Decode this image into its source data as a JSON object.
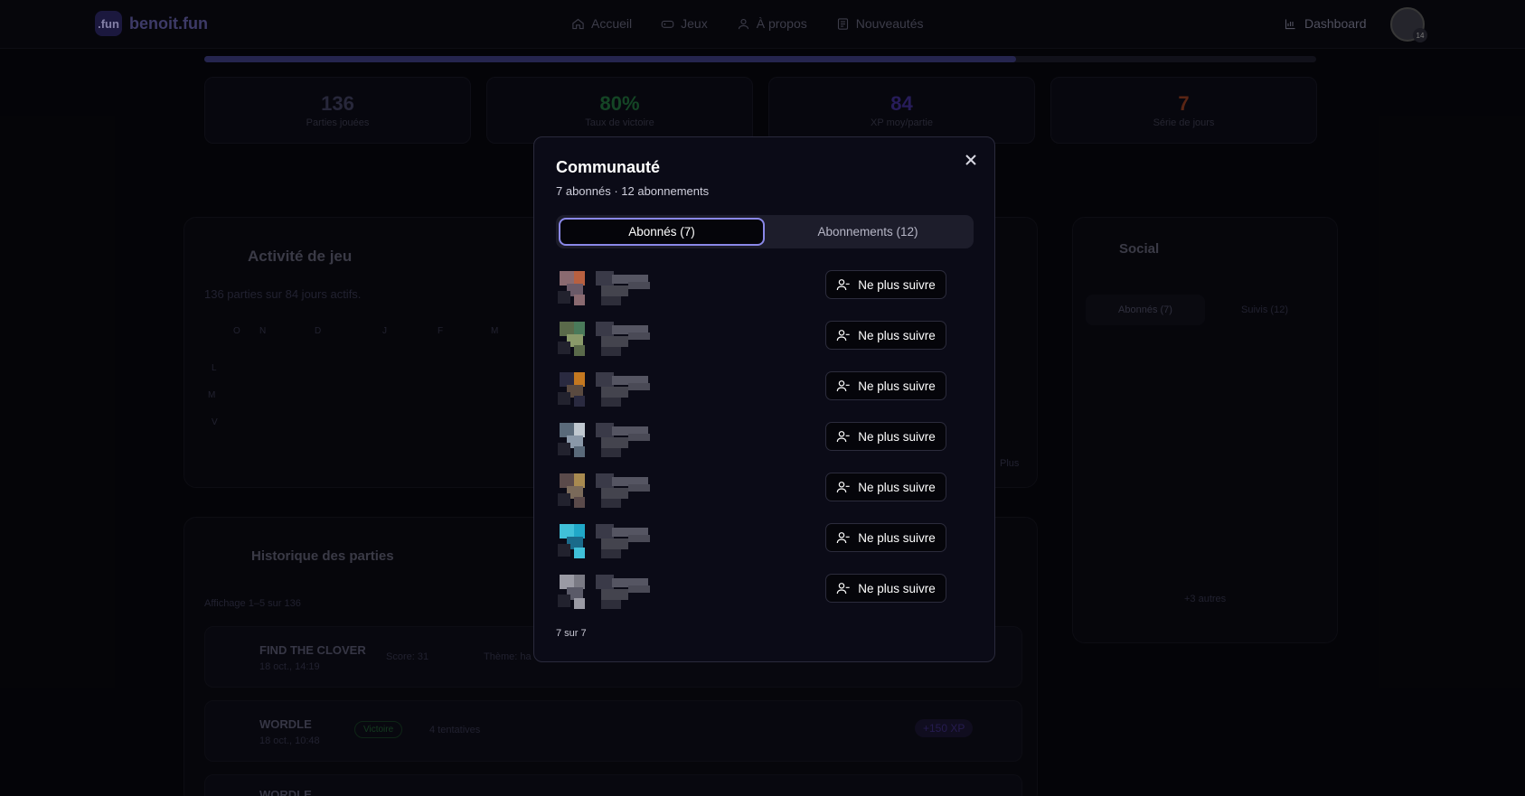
{
  "header": {
    "logo_badge": ".fun",
    "logo_text": "benoit.fun",
    "nav": [
      {
        "label": "Accueil",
        "icon": "home-icon"
      },
      {
        "label": "Jeux",
        "icon": "gamepad-icon"
      },
      {
        "label": "À propos",
        "icon": "user-icon"
      },
      {
        "label": "Nouveautés",
        "icon": "newspaper-icon"
      }
    ],
    "dashboard_label": "Dashboard",
    "avatar_badge": "14"
  },
  "level_progress": 0.73,
  "stats": [
    {
      "value": "136",
      "label": "Parties jouées",
      "color": "#3c3c5a"
    },
    {
      "value": "80%",
      "label": "Taux de victoire",
      "color": "#1f6a3a"
    },
    {
      "value": "84",
      "label": "XP moy/partie",
      "color": "#3c2c8a"
    },
    {
      "value": "7",
      "label": "Série de jours",
      "color": "#8a3a20"
    }
  ],
  "activity": {
    "title": "Activité de jeu",
    "subtitle": "136 parties sur 84 jours actifs.",
    "months": [
      "O",
      "N",
      "D",
      "J",
      "F",
      "M"
    ],
    "days": [
      "L",
      "M",
      "V"
    ],
    "more": "Plus"
  },
  "history": {
    "title": "Historique des parties",
    "showing": "Affichage 1–5 sur 136",
    "rows": [
      {
        "name": "FIND THE CLOVER",
        "date": "18 oct., 14:19",
        "score": "Score: 31",
        "theme": "Thème: ha"
      },
      {
        "name": "WORDLE",
        "date": "18 oct., 10:48",
        "badge": "Victoire",
        "attempts": "4 tentatives",
        "xp": "+150 XP"
      },
      {
        "name": "WORDLE"
      }
    ]
  },
  "social": {
    "title": "Social",
    "tabs": [
      "Abonnés (7)",
      "Suivis (12)"
    ],
    "others": "+3 autres"
  },
  "modal": {
    "title": "Communauté",
    "subtitle": "7 abonnés · 12 abonnements",
    "tabs": [
      "Abonnés (7)",
      "Abonnements (12)"
    ],
    "unfollow_label": "Ne plus suivre",
    "footer": "7 sur 7",
    "followers": [
      {
        "avatar_colors": [
          "#b86040",
          "#6a5a68",
          "#8a6a70"
        ]
      },
      {
        "avatar_colors": [
          "#4a7a5a",
          "#8a9a6a",
          "#5a6a4a"
        ]
      },
      {
        "avatar_colors": [
          "#c47820",
          "#5a4a40",
          "#2a2a40"
        ]
      },
      {
        "avatar_colors": [
          "#c0c8d0",
          "#8a98a8",
          "#5a6a7a"
        ]
      },
      {
        "avatar_colors": [
          "#a88a50",
          "#7a6a5a",
          "#5a4a4a"
        ]
      },
      {
        "avatar_colors": [
          "#20a8c8",
          "#1a6a8a",
          "#40c0d8"
        ]
      },
      {
        "avatar_colors": [
          "#7a7a84",
          "#5a5a68",
          "#9a9aa4"
        ]
      }
    ]
  }
}
